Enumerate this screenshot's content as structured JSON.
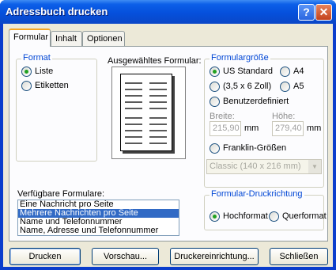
{
  "window": {
    "title": "Adressbuch drucken",
    "help_icon": "?",
    "close_icon": "✕"
  },
  "tabs": [
    {
      "label": "Formular"
    },
    {
      "label": "Inhalt"
    },
    {
      "label": "Optionen"
    }
  ],
  "format": {
    "group_label": "Format",
    "options": [
      {
        "label": "Liste",
        "selected": true
      },
      {
        "label": "Etiketten",
        "selected": false
      }
    ]
  },
  "selected_form": {
    "label": "Ausgewähltes Formular:"
  },
  "form_size": {
    "group_label": "Formulargröße",
    "options": [
      {
        "label": "US Standard",
        "selected": true
      },
      {
        "label": "A4",
        "selected": false
      },
      {
        "label": "(3,5 x 6 Zoll)",
        "selected": false
      },
      {
        "label": "A5",
        "selected": false
      },
      {
        "label": "Benutzerdefiniert",
        "selected": false
      }
    ],
    "width_label": "Breite:",
    "height_label": "Höhe:",
    "width_value": "215,90",
    "height_value": "279,40",
    "unit": "mm",
    "franklin_label": "Franklin-Größen",
    "franklin_selected": false,
    "franklin_combo_value": "Classic  (140 x 216 mm)"
  },
  "available_forms": {
    "label": "Verfügbare Formulare:",
    "items": [
      {
        "label": "Eine Nachricht pro Seite",
        "selected": false
      },
      {
        "label": "Mehrere Nachrichten pro Seite",
        "selected": true
      },
      {
        "label": "Name und Telefonnummer",
        "selected": false
      },
      {
        "label": "Name, Adresse und Telefonnummer",
        "selected": false
      }
    ]
  },
  "orientation": {
    "group_label": "Formular-Druckrichtung",
    "options": [
      {
        "label": "Hochformat",
        "selected": true
      },
      {
        "label": "Querformat",
        "selected": false
      }
    ]
  },
  "buttons": {
    "print": "Drucken",
    "preview": "Vorschau...",
    "printer_setup": "Druckereinrichtung...",
    "close": "Schließen"
  },
  "colors": {
    "titlebar": "#0550dc",
    "group_label": "#0046d5",
    "selection": "#316ac5",
    "dialog_bg": "#ece9d8"
  }
}
